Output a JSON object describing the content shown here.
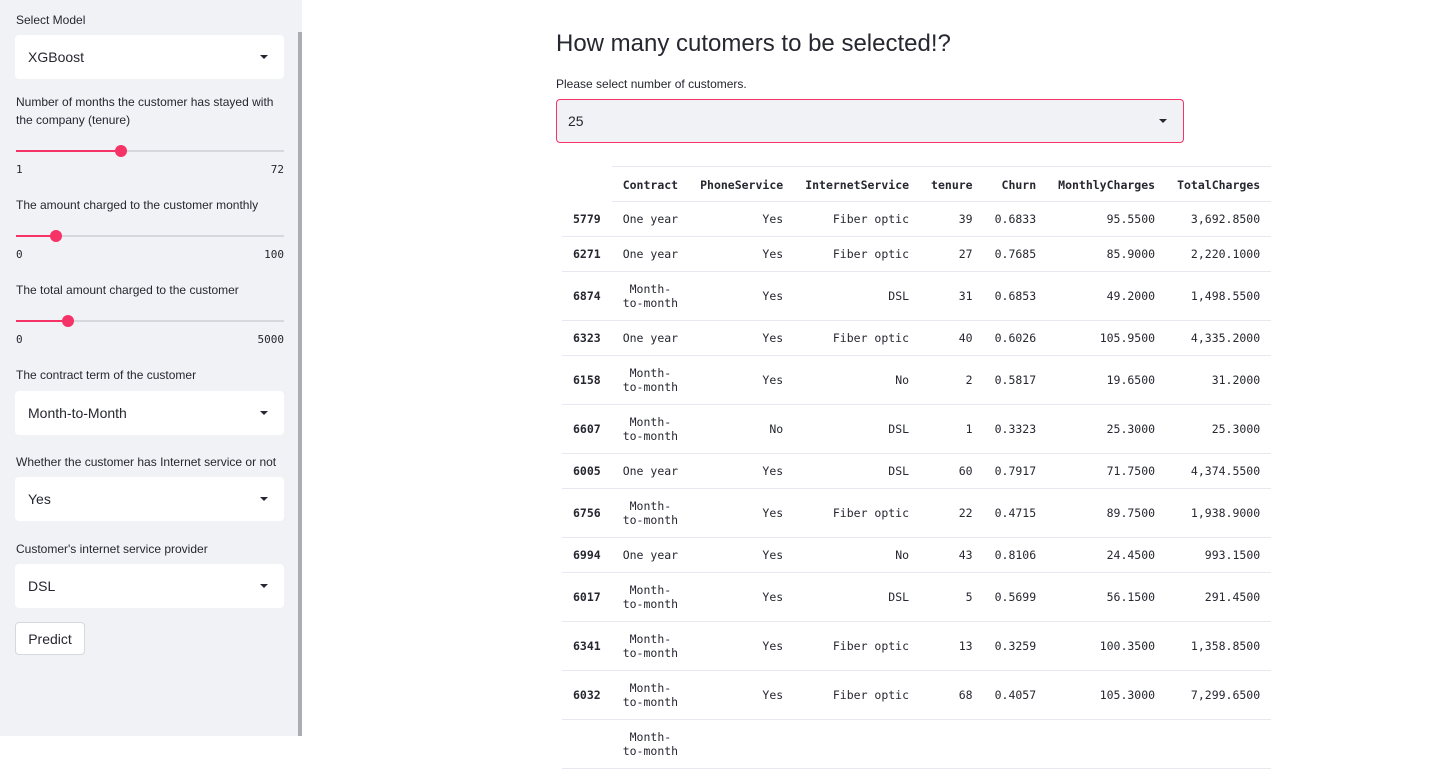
{
  "sidebar": {
    "model": {
      "label": "Select Model",
      "value": "XGBoost"
    },
    "tenure": {
      "label": "Number of months the customer has stayed with the company (tenure)",
      "min": "1",
      "max": "72",
      "value_fraction": 0.39
    },
    "monthly": {
      "label": "The amount charged to the customer monthly",
      "min": "0",
      "max": "100",
      "value_fraction": 0.15
    },
    "total": {
      "label": "The total amount charged to the customer",
      "min": "0",
      "max": "5000",
      "value_fraction": 0.195
    },
    "contract": {
      "label": "The contract term of the customer",
      "value": "Month-to-Month"
    },
    "internet": {
      "label": "Whether the customer has Internet service or not",
      "value": "Yes"
    },
    "provider": {
      "label": "Customer's internet service provider",
      "value": "DSL"
    },
    "predict_label": "Predict"
  },
  "main": {
    "title": "How many cutomers to be selected!?",
    "select_label": "Please select number of customers.",
    "select_value": "25"
  },
  "table": {
    "columns": [
      "Contract",
      "PhoneService",
      "InternetService",
      "tenure",
      "Churn",
      "MonthlyCharges",
      "TotalCharges"
    ],
    "rows": [
      {
        "idx": "5779",
        "contract": [
          "One year"
        ],
        "phone": "Yes",
        "internet": "Fiber optic",
        "tenure": "39",
        "churn": "0.6833",
        "monthly": "95.5500",
        "total": "3,692.8500"
      },
      {
        "idx": "6271",
        "contract": [
          "One year"
        ],
        "phone": "Yes",
        "internet": "Fiber optic",
        "tenure": "27",
        "churn": "0.7685",
        "monthly": "85.9000",
        "total": "2,220.1000"
      },
      {
        "idx": "6874",
        "contract": [
          "Month-",
          "to-month"
        ],
        "phone": "Yes",
        "internet": "DSL",
        "tenure": "31",
        "churn": "0.6853",
        "monthly": "49.2000",
        "total": "1,498.5500"
      },
      {
        "idx": "6323",
        "contract": [
          "One year"
        ],
        "phone": "Yes",
        "internet": "Fiber optic",
        "tenure": "40",
        "churn": "0.6026",
        "monthly": "105.9500",
        "total": "4,335.2000"
      },
      {
        "idx": "6158",
        "contract": [
          "Month-",
          "to-month"
        ],
        "phone": "Yes",
        "internet": "No",
        "tenure": "2",
        "churn": "0.5817",
        "monthly": "19.6500",
        "total": "31.2000"
      },
      {
        "idx": "6607",
        "contract": [
          "Month-",
          "to-month"
        ],
        "phone": "No",
        "internet": "DSL",
        "tenure": "1",
        "churn": "0.3323",
        "monthly": "25.3000",
        "total": "25.3000"
      },
      {
        "idx": "6005",
        "contract": [
          "One year"
        ],
        "phone": "Yes",
        "internet": "DSL",
        "tenure": "60",
        "churn": "0.7917",
        "monthly": "71.7500",
        "total": "4,374.5500"
      },
      {
        "idx": "6756",
        "contract": [
          "Month-",
          "to-month"
        ],
        "phone": "Yes",
        "internet": "Fiber optic",
        "tenure": "22",
        "churn": "0.4715",
        "monthly": "89.7500",
        "total": "1,938.9000"
      },
      {
        "idx": "6994",
        "contract": [
          "One year"
        ],
        "phone": "Yes",
        "internet": "No",
        "tenure": "43",
        "churn": "0.8106",
        "monthly": "24.4500",
        "total": "993.1500"
      },
      {
        "idx": "6017",
        "contract": [
          "Month-",
          "to-month"
        ],
        "phone": "Yes",
        "internet": "DSL",
        "tenure": "5",
        "churn": "0.5699",
        "monthly": "56.1500",
        "total": "291.4500"
      },
      {
        "idx": "6341",
        "contract": [
          "Month-",
          "to-month"
        ],
        "phone": "Yes",
        "internet": "Fiber optic",
        "tenure": "13",
        "churn": "0.3259",
        "monthly": "100.3500",
        "total": "1,358.8500"
      },
      {
        "idx": "6032",
        "contract": [
          "Month-",
          "to-month"
        ],
        "phone": "Yes",
        "internet": "Fiber optic",
        "tenure": "68",
        "churn": "0.4057",
        "monthly": "105.3000",
        "total": "7,299.6500"
      },
      {
        "idx": "",
        "contract": [
          "Month-",
          "to-month"
        ],
        "phone": "",
        "internet": "",
        "tenure": "",
        "churn": "",
        "monthly": "",
        "total": ""
      }
    ]
  },
  "colors": {
    "accent": "#f63366",
    "sidebar_bg": "#f0f2f6",
    "text": "#262730"
  }
}
